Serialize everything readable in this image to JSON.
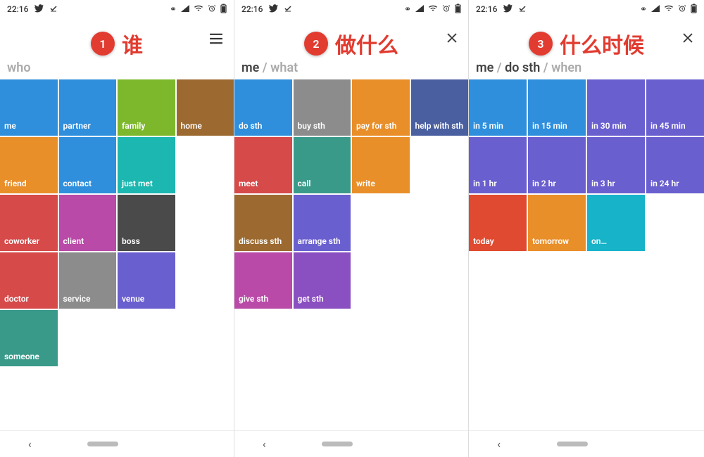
{
  "status": {
    "time": "22:16",
    "icons_left": [
      "twitter-icon",
      "check-icon"
    ],
    "icons_right": [
      "link-icon",
      "signal-icon",
      "wifi-icon",
      "alarm-icon",
      "battery-icon"
    ]
  },
  "screens": [
    {
      "step": "1",
      "step_label": "谁",
      "toolbar_icon": "menu",
      "breadcrumb": [
        {
          "text": "who",
          "active": false
        }
      ],
      "tiles": [
        {
          "label": "me",
          "color": "#2f8fdc"
        },
        {
          "label": "partner",
          "color": "#2f8fdc"
        },
        {
          "label": "family",
          "color": "#7db82c"
        },
        {
          "label": "home",
          "color": "#9c6a30"
        },
        {
          "label": "friend",
          "color": "#e98f2a"
        },
        {
          "label": "contact",
          "color": "#2f8fdc"
        },
        {
          "label": "just met",
          "color": "#1bb7b0"
        },
        null,
        {
          "label": "coworker",
          "color": "#d64a4a"
        },
        {
          "label": "client",
          "color": "#b94aa8"
        },
        {
          "label": "boss",
          "color": "#4a4a4a"
        },
        null,
        {
          "label": "doctor",
          "color": "#d64a4a"
        },
        {
          "label": "service",
          "color": "#8c8c8c"
        },
        {
          "label": "venue",
          "color": "#6a5fcf"
        },
        null,
        {
          "label": "someone",
          "color": "#3a9a8a"
        }
      ]
    },
    {
      "step": "2",
      "step_label": "做什么",
      "toolbar_icon": "close",
      "breadcrumb": [
        {
          "text": "me",
          "active": true
        },
        {
          "text": " / ",
          "active": false
        },
        {
          "text": "what",
          "active": false
        }
      ],
      "tiles": [
        {
          "label": "do sth",
          "color": "#2f8fdc"
        },
        {
          "label": "buy sth",
          "color": "#8c8c8c"
        },
        {
          "label": "pay for sth",
          "color": "#e98f2a"
        },
        {
          "label": "help with sth",
          "color": "#4a5fa0"
        },
        {
          "label": "meet",
          "color": "#d64a4a"
        },
        {
          "label": "call",
          "color": "#3a9a8a"
        },
        {
          "label": "write",
          "color": "#e98f2a"
        },
        null,
        {
          "label": "discuss sth",
          "color": "#9c6a30"
        },
        {
          "label": "arrange sth",
          "color": "#6a5fcf"
        },
        null,
        null,
        {
          "label": "give sth",
          "color": "#b94aa8"
        },
        {
          "label": "get sth",
          "color": "#8a4fc0"
        }
      ]
    },
    {
      "step": "3",
      "step_label": "什么时候",
      "toolbar_icon": "close",
      "breadcrumb": [
        {
          "text": "me",
          "active": true
        },
        {
          "text": " / ",
          "active": false
        },
        {
          "text": "do sth",
          "active": true
        },
        {
          "text": " / ",
          "active": false
        },
        {
          "text": "when",
          "active": false
        }
      ],
      "tiles": [
        {
          "label": "in 5 min",
          "color": "#2f8fdc"
        },
        {
          "label": "in 15 min",
          "color": "#2f8fdc"
        },
        {
          "label": "in 30 min",
          "color": "#6a5fcf"
        },
        {
          "label": "in 45 min",
          "color": "#6a5fcf"
        },
        {
          "label": "in 1 hr",
          "color": "#6a5fcf"
        },
        {
          "label": "in 2 hr",
          "color": "#6a5fcf"
        },
        {
          "label": "in 3 hr",
          "color": "#6a5fcf"
        },
        {
          "label": "in 24 hr",
          "color": "#6a5fcf"
        },
        {
          "label": "today",
          "color": "#e04a30"
        },
        {
          "label": "tomorrow",
          "color": "#e98f2a"
        },
        {
          "label": "on…",
          "color": "#16b3c9"
        }
      ]
    }
  ],
  "nav": {
    "back": "‹"
  }
}
